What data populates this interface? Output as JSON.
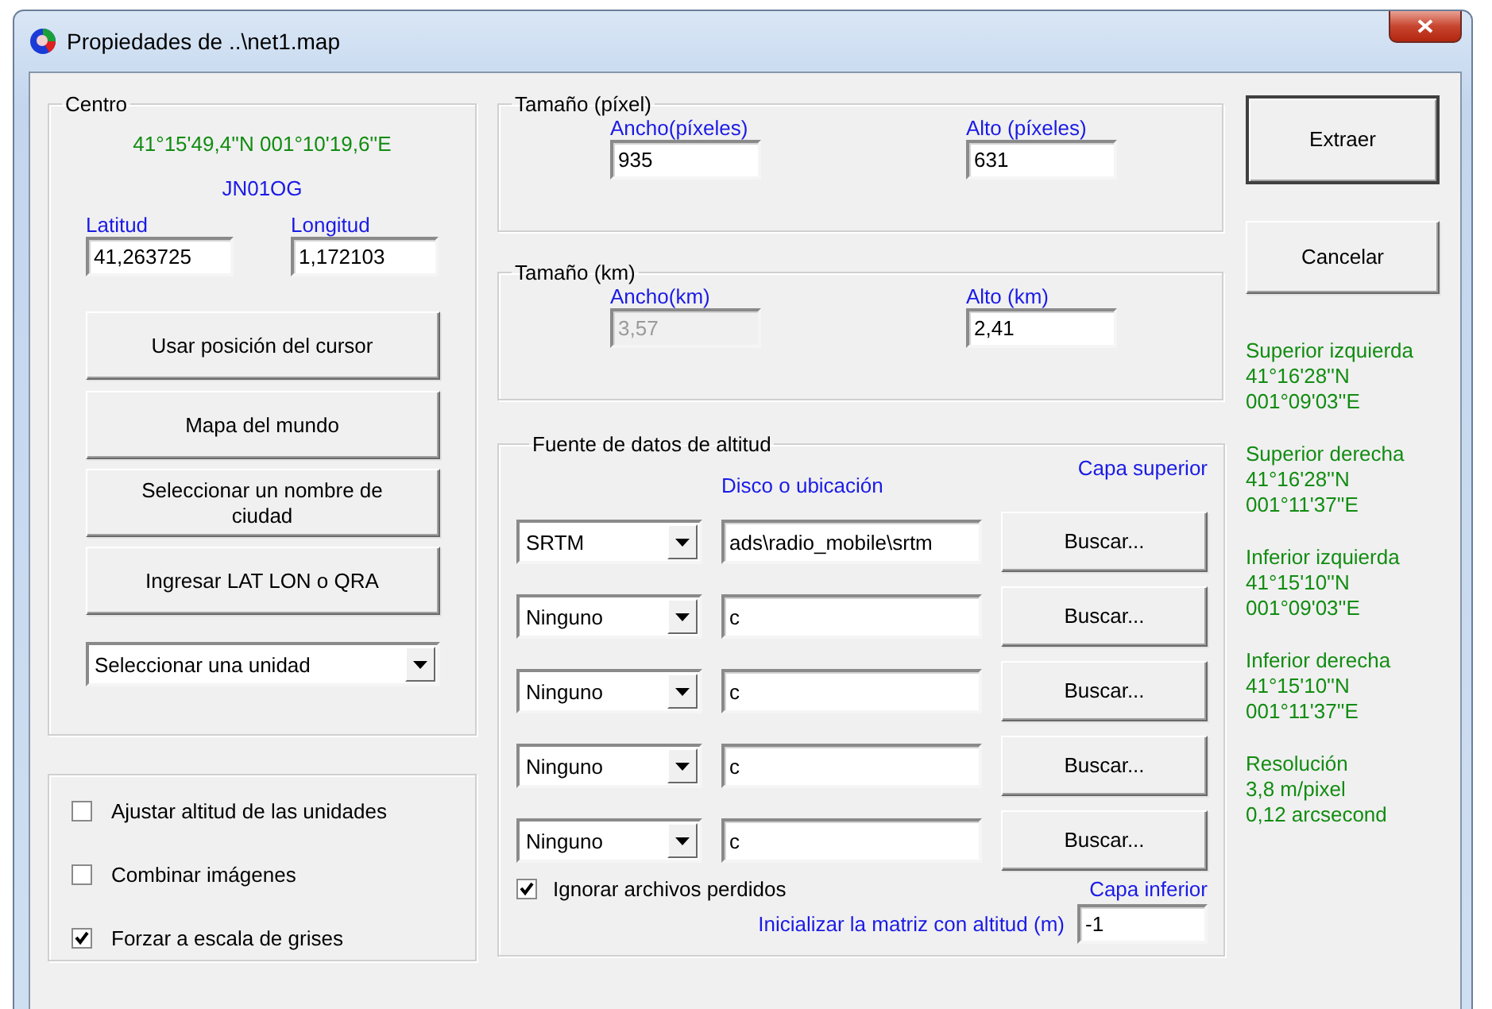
{
  "window": {
    "title": "Propiedades de ..\\net1.map"
  },
  "centro": {
    "title": "Centro",
    "coordinates": "41°15'49,4''N 001°10'19,6''E",
    "locator": "JN01OG",
    "latitude": {
      "label": "Latitud",
      "value": "41,263725"
    },
    "longitude": {
      "label": "Longitud",
      "value": "1,172103"
    },
    "buttons": [
      "Usar posición del cursor",
      "Mapa del mundo",
      "Seleccionar un nombre de ciudad",
      "Ingresar LAT LON o QRA"
    ],
    "unit_select": {
      "value": "Seleccionar una unidad"
    }
  },
  "options": [
    {
      "label": "Ajustar altitud de las unidades",
      "checked": false
    },
    {
      "label": "Combinar imágenes",
      "checked": false
    },
    {
      "label": "Forzar a escala de grises",
      "checked": true
    }
  ],
  "size_pixels": {
    "title": "Tamaño (píxel)",
    "width": {
      "label": "Ancho(píxeles)",
      "value": "935",
      "disabled": false
    },
    "height": {
      "label": "Alto (píxeles)",
      "value": "631",
      "disabled": false
    }
  },
  "size_km": {
    "title": "Tamaño (km)",
    "width": {
      "label": "Ancho(km)",
      "value": "3,57",
      "disabled": true
    },
    "height": {
      "label": "Alto (km)",
      "value": "2,41",
      "disabled": false
    }
  },
  "elevation": {
    "title": "Fuente de datos de altitud",
    "path_header": "Disco o ubicación",
    "top_layer": "Capa superior",
    "bottom_layer": "Capa inferior",
    "sources": [
      {
        "source": "SRTM",
        "path": "ads\\radio_mobile\\srtm",
        "button": "Buscar..."
      },
      {
        "source": "Ninguno",
        "path": "c",
        "button": "Buscar..."
      },
      {
        "source": "Ninguno",
        "path": "c",
        "button": "Buscar..."
      },
      {
        "source": "Ninguno",
        "path": "c",
        "button": "Buscar..."
      },
      {
        "source": "Ninguno",
        "path": "c",
        "button": "Buscar..."
      }
    ],
    "ignore_missing": {
      "label": "Ignorar archivos perdidos",
      "checked": true
    },
    "init_label": "Inicializar la matriz con altitud (m)",
    "init_value": "-1"
  },
  "actions": [
    {
      "label": "Extraer",
      "default": true
    },
    {
      "label": "Cancelar",
      "default": false
    }
  ],
  "corners": [
    {
      "title": "Superior izquierda",
      "lines": [
        "41°16'28''N",
        "001°09'03''E"
      ]
    },
    {
      "title": "Superior derecha",
      "lines": [
        "41°16'28''N",
        "001°11'37''E"
      ]
    },
    {
      "title": "Inferior izquierda",
      "lines": [
        "41°15'10''N",
        "001°09'03''E"
      ]
    },
    {
      "title": "Inferior derecha",
      "lines": [
        "41°15'10''N",
        "001°11'37''E"
      ]
    },
    {
      "title": "Resolución",
      "lines": [
        "3,8 m/pixel",
        "0,12 arcsecond"
      ]
    }
  ]
}
